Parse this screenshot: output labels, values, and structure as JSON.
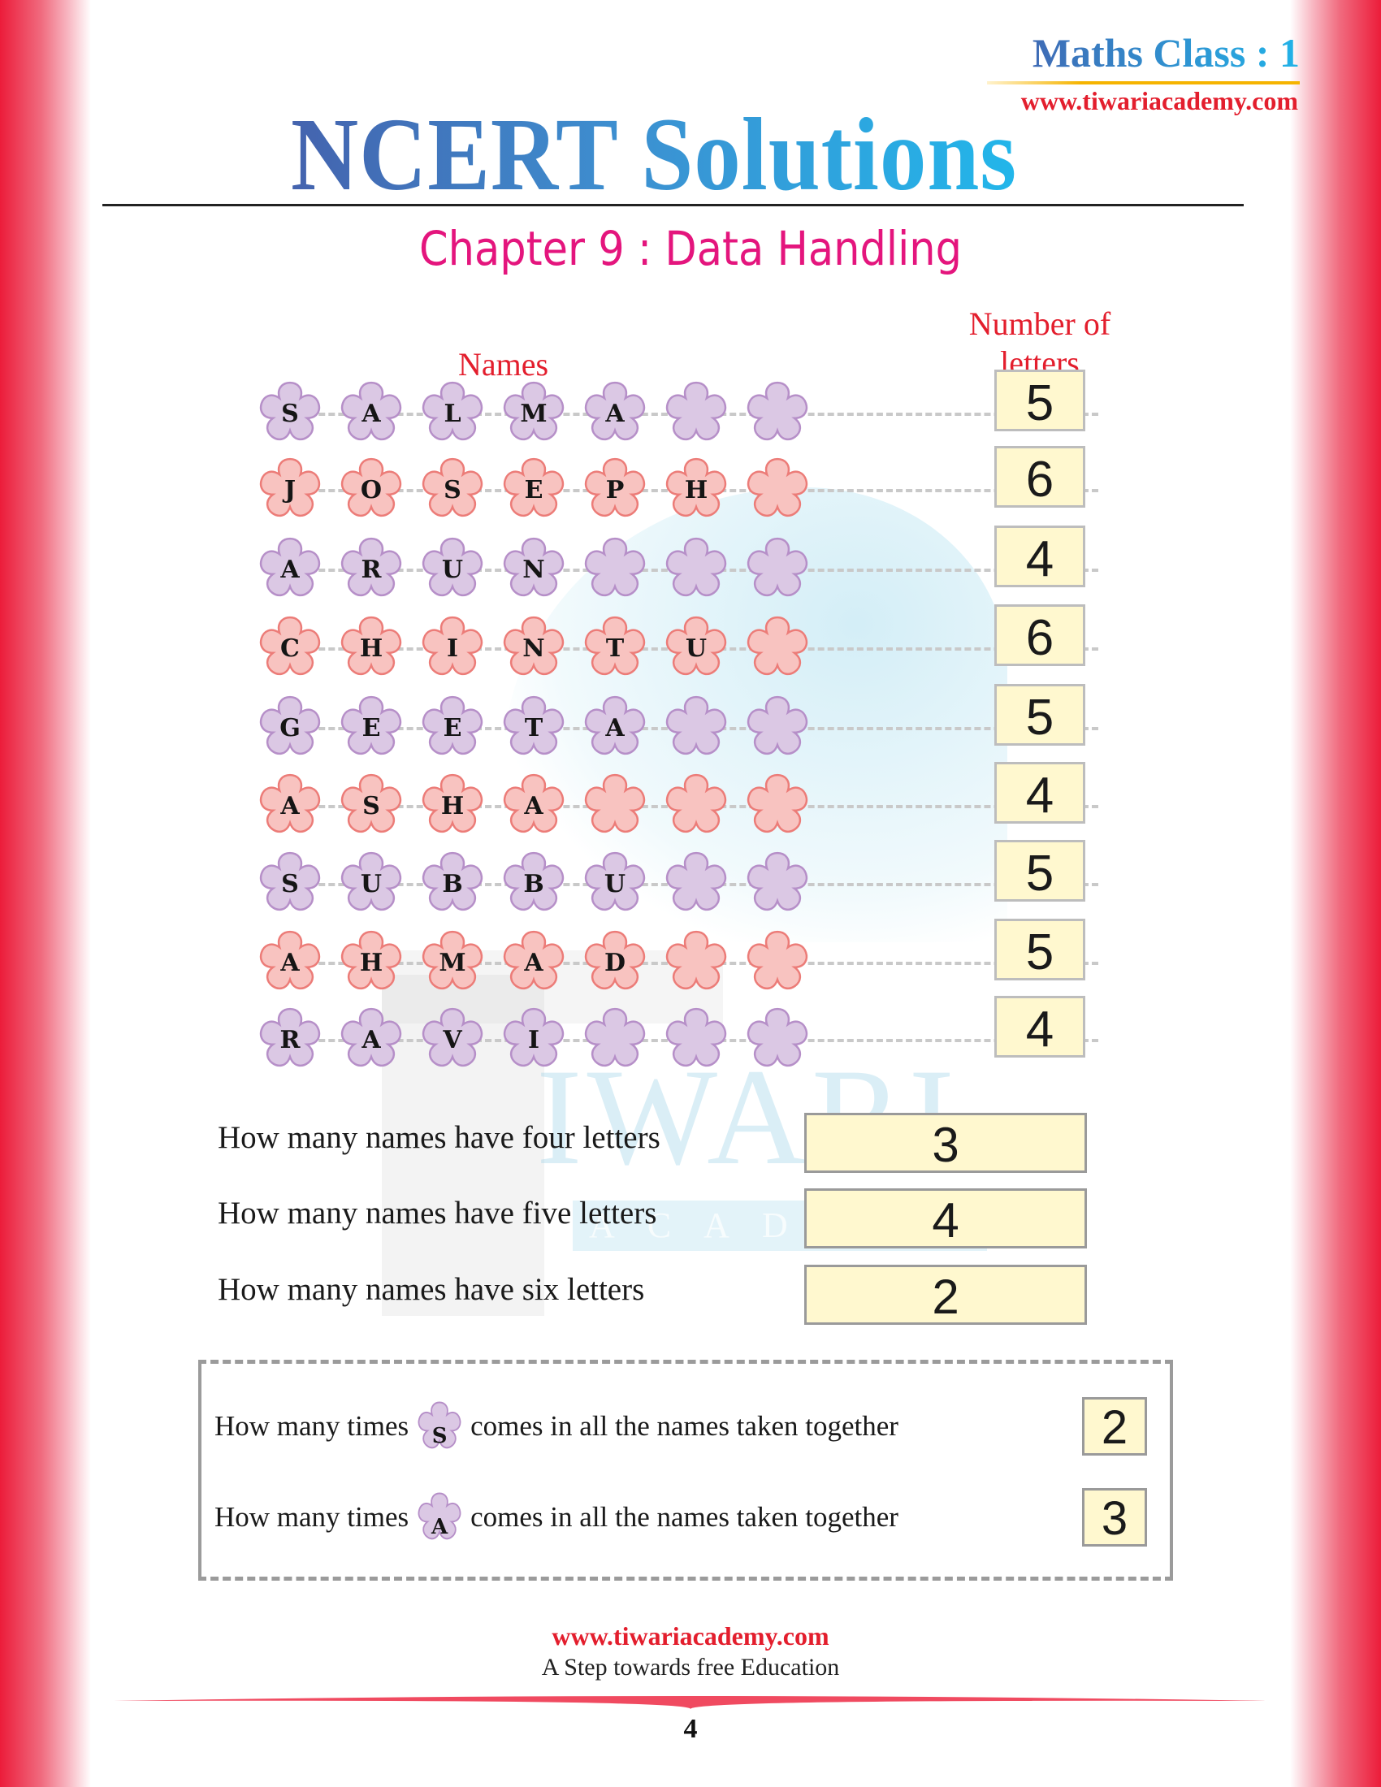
{
  "header": {
    "class_label": "Maths Class : 1",
    "site_url": "www.tiwariacademy.com",
    "title_part1": "NCERT",
    "title_part2": "Solutions",
    "chapter": "Chapter 9 : Data Handling"
  },
  "table": {
    "col_names": "Names",
    "col_count_line1": "Number of",
    "col_count_line2": "letters",
    "colors": {
      "purple": "#dbc8e4",
      "purple_stroke": "#b68fc8",
      "pink": "#f8c3c0",
      "pink_stroke": "#ec7c78"
    },
    "slots_per_row": 7,
    "rows": [
      {
        "name": "SALMA",
        "letters": [
          "S",
          "A",
          "L",
          "M",
          "A"
        ],
        "color": "purple",
        "count": "5"
      },
      {
        "name": "JOSEPH",
        "letters": [
          "J",
          "O",
          "S",
          "E",
          "P",
          "H"
        ],
        "color": "pink",
        "count": "6"
      },
      {
        "name": "ARUN",
        "letters": [
          "A",
          "R",
          "U",
          "N"
        ],
        "color": "purple",
        "count": "4"
      },
      {
        "name": "CHINTU",
        "letters": [
          "C",
          "H",
          "I",
          "N",
          "T",
          "U"
        ],
        "color": "pink",
        "count": "6"
      },
      {
        "name": "GEETA",
        "letters": [
          "G",
          "E",
          "E",
          "T",
          "A"
        ],
        "color": "purple",
        "count": "5"
      },
      {
        "name": "ASHA",
        "letters": [
          "A",
          "S",
          "H",
          "A"
        ],
        "color": "pink",
        "count": "4"
      },
      {
        "name": "SUBBU",
        "letters": [
          "S",
          "U",
          "B",
          "B",
          "U"
        ],
        "color": "purple",
        "count": "5"
      },
      {
        "name": "AHMAD",
        "letters": [
          "A",
          "H",
          "M",
          "A",
          "D"
        ],
        "color": "pink",
        "count": "5"
      },
      {
        "name": "RAVI",
        "letters": [
          "R",
          "A",
          "V",
          "I"
        ],
        "color": "purple",
        "count": "4"
      }
    ]
  },
  "questions": [
    {
      "text": "How many names have four letters",
      "answer": "3"
    },
    {
      "text": "How many names have five letters",
      "answer": "4"
    },
    {
      "text": "How many names have six letters",
      "answer": "2"
    }
  ],
  "letter_questions": [
    {
      "prefix": "How many times",
      "letter": "S",
      "suffix": "comes in all the names taken together",
      "answer": "2"
    },
    {
      "prefix": "How many times",
      "letter": "A",
      "suffix": "comes in all the names taken together",
      "answer": "3"
    }
  ],
  "watermark": {
    "main": "TIWARI",
    "sub": "ACADEMY"
  },
  "footer": {
    "url": "www.tiwariacademy.com",
    "tagline": "A Step towards free Education",
    "page_number": "4"
  }
}
